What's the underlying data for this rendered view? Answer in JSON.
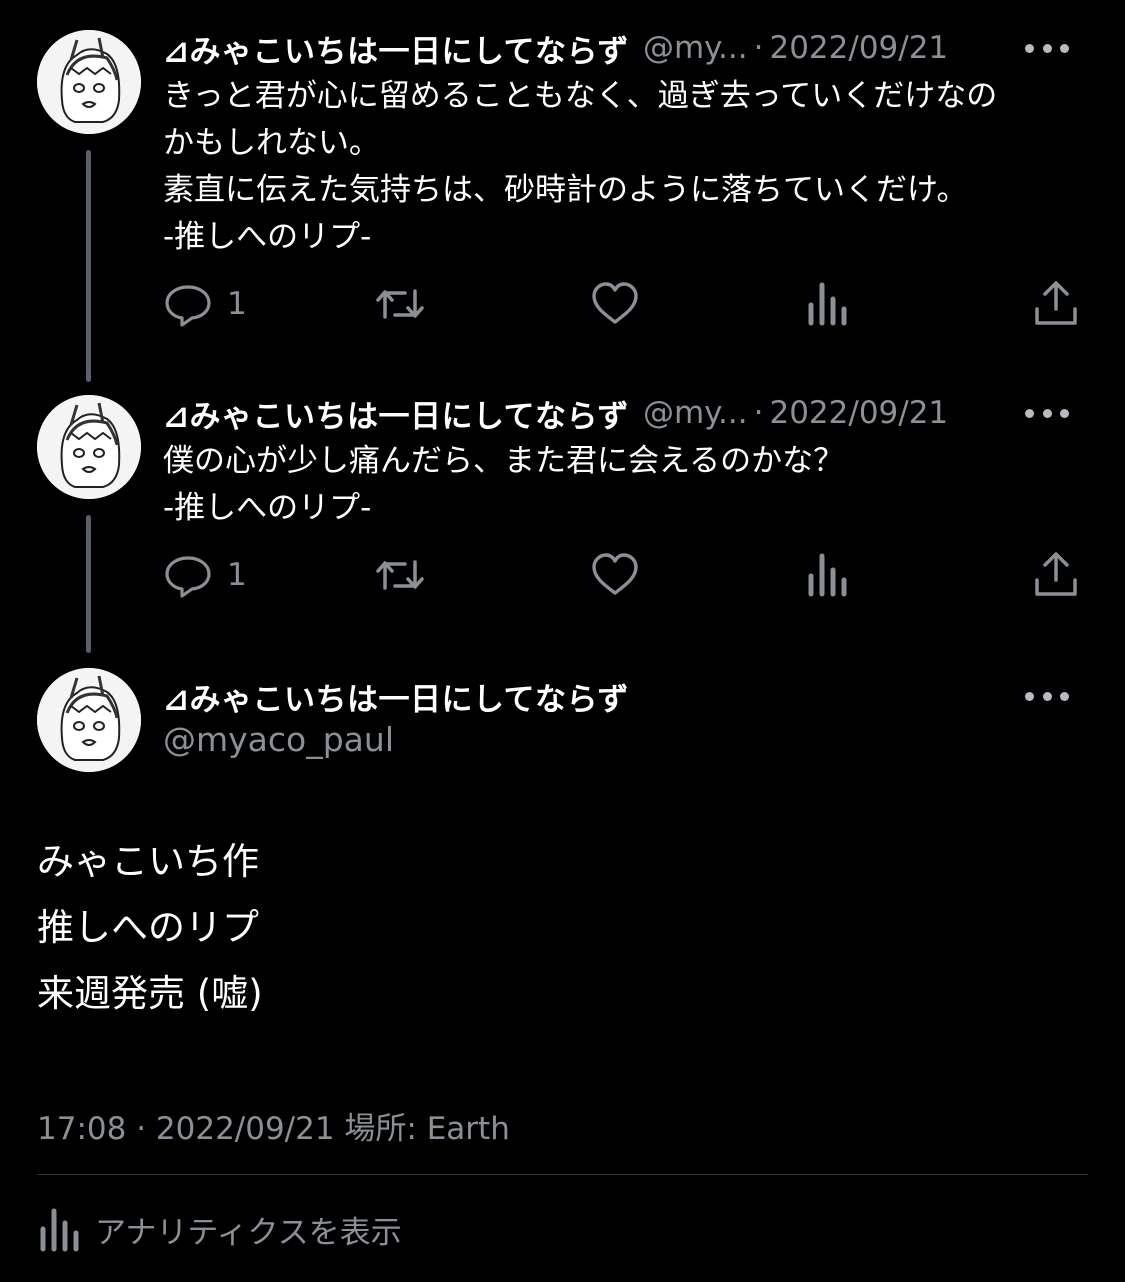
{
  "tweets": [
    {
      "name": "⊿みゃこいちは一日にしてならず",
      "handle": "@my...",
      "separator": "·",
      "date": "2022/09/21",
      "lines": [
        "きっと君が心に留めることもなく、過ぎ去っていくだけなの",
        "かもしれない。",
        "素直に伝えた気持ちは、砂時計のように落ちていくだけ。",
        "-推しへのリプ-"
      ],
      "reply_count": "1"
    },
    {
      "name": "⊿みゃこいちは一日にしてならず",
      "handle": "@my...",
      "separator": "·",
      "date": "2022/09/21",
      "lines": [
        "僕の心が少し痛んだら、また君に会えるのかな？",
        "-推しへのリプ-"
      ],
      "reply_count": "1"
    }
  ],
  "main_tweet": {
    "name": "⊿みゃこいちは一日にしてならず",
    "handle": "@myaco_paul",
    "lines": [
      "みゃこいち作",
      "推しへのリプ",
      "来週発売 (嘘)"
    ],
    "meta": "17:08 · 2022/09/21 場所: Earth",
    "analytics_label": "アナリティクスを表示"
  },
  "icons": {
    "reply": "reply-icon",
    "retweet": "retweet-icon",
    "like": "like-icon",
    "views": "views-icon",
    "share": "share-icon",
    "more": "more-icon"
  },
  "colors": {
    "background": "#000000",
    "text": "#ffffff",
    "muted": "#8b9096",
    "thread_line": "#5b5f66",
    "divider": "#2f3336"
  }
}
